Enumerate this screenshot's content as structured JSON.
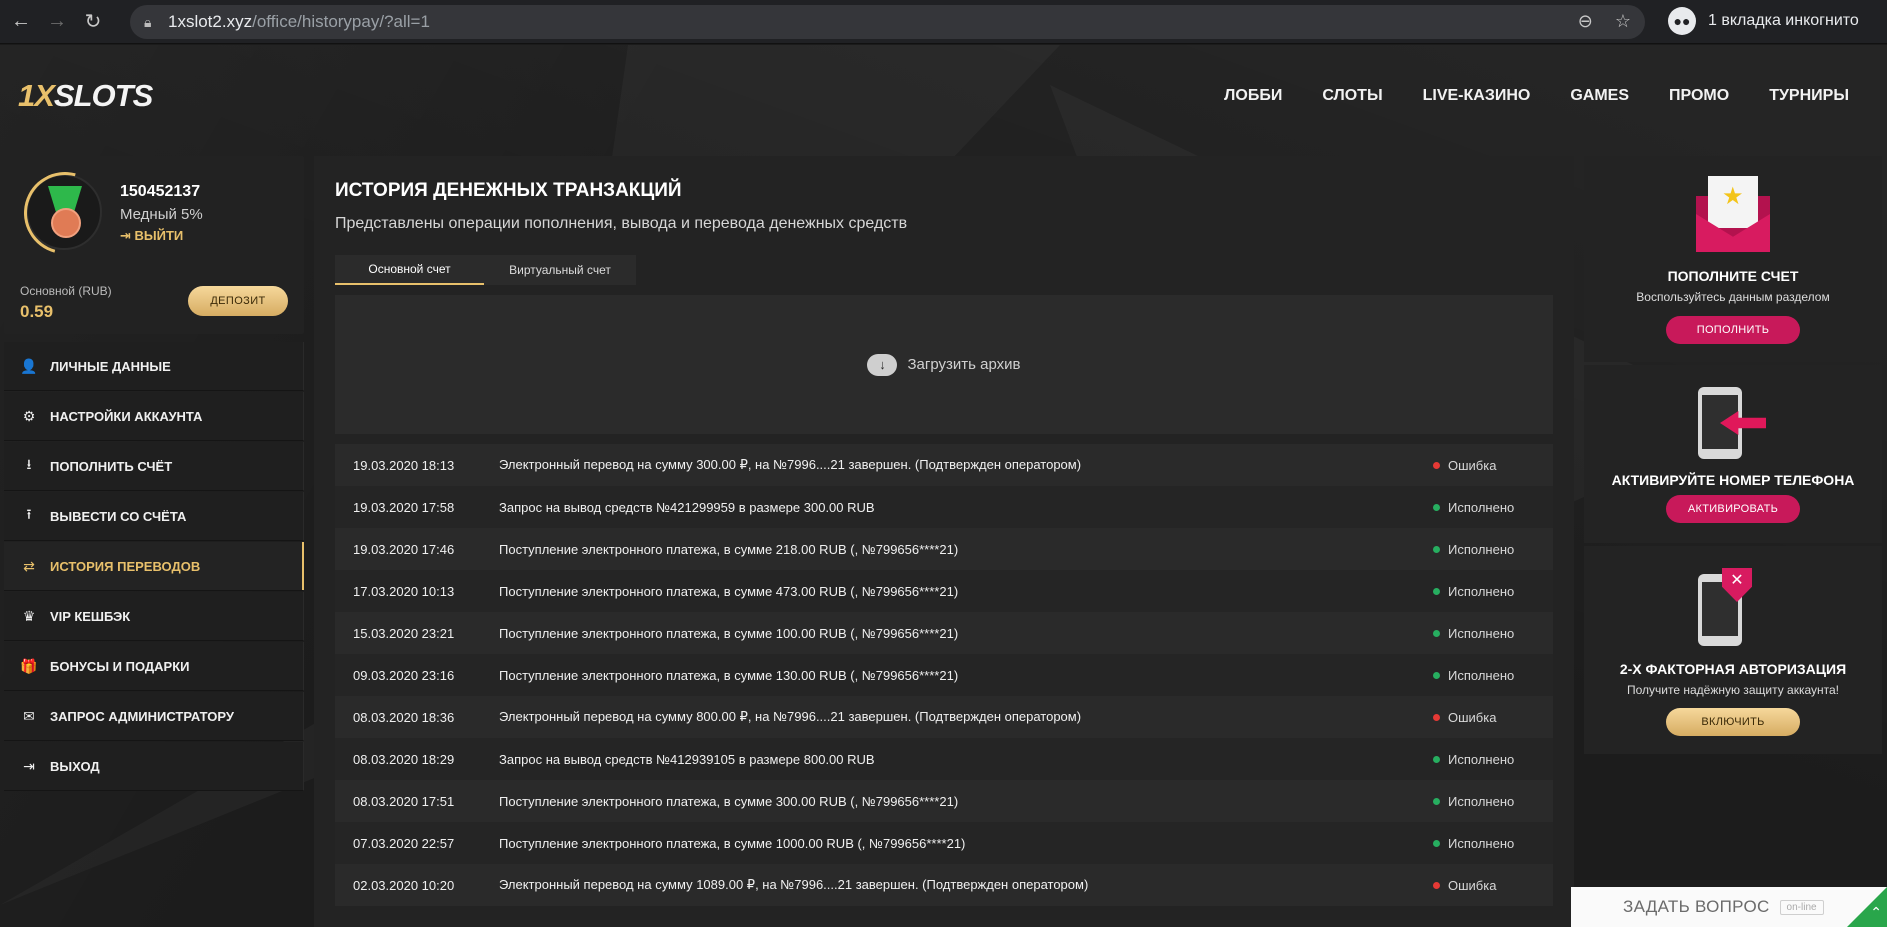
{
  "browser": {
    "url_host": "1xslot2.xyz",
    "url_path": "/office/historypay/?all=1",
    "incognito_label": "1 вкладка инкогнито"
  },
  "header": {
    "logo_one": "1X",
    "logo_rest": "SLOTS",
    "nav": [
      "ЛОББИ",
      "СЛОТЫ",
      "LIVE-КАЗИНО",
      "GAMES",
      "ПРОМО",
      "ТУРНИРЫ"
    ]
  },
  "profile": {
    "user_id": "150452137",
    "rank": "Медный 5%",
    "logout": "ВЫЙТИ",
    "account_label": "Основной (RUB)",
    "balance": "0.59",
    "deposit_label": "ДЕПОЗИТ"
  },
  "menu": [
    {
      "label": "ЛИЧНЫЕ ДАННЫЕ",
      "icon": "user-add-icon",
      "glyph": "👤"
    },
    {
      "label": "НАСТРОЙКИ АККАУНТА",
      "icon": "gears-icon",
      "glyph": "⚙"
    },
    {
      "label": "ПОПОЛНИТЬ СЧЁТ",
      "icon": "download-icon",
      "glyph": "⭳"
    },
    {
      "label": "ВЫВЕСТИ СО СЧЁТА",
      "icon": "upload-icon",
      "glyph": "⭱"
    },
    {
      "label": "ИСТОРИЯ ПЕРЕВОДОВ",
      "icon": "transfer-icon",
      "glyph": "⇄",
      "active": true
    },
    {
      "label": "VIP КЕШБЭК",
      "icon": "crown-icon",
      "glyph": "♛"
    },
    {
      "label": "БОНУСЫ И ПОДАРКИ",
      "icon": "gift-icon",
      "glyph": "🎁"
    },
    {
      "label": "ЗАПРОС АДМИНИСТРАТОРУ",
      "icon": "envelope-icon",
      "glyph": "✉"
    },
    {
      "label": "ВЫХОД",
      "icon": "exit-icon",
      "glyph": "⇥"
    }
  ],
  "main": {
    "title": "ИСТОРИЯ ДЕНЕЖНЫХ ТРАНЗАКЦИЙ",
    "subtitle": "Представлены операции пополнения, вывода и перевода денежных средств",
    "tabs": [
      "Основной счет",
      "Виртуальный счет"
    ],
    "archive_label": "Загрузить архив"
  },
  "transactions": [
    {
      "date": "19.03.2020 18:13",
      "desc": "Электронный перевод на сумму 300.00 ₽, на №7996....21 завершен. (Подтвержден оператором)",
      "status": "Ошибка",
      "ok": false
    },
    {
      "date": "19.03.2020 17:58",
      "desc": "Запрос на вывод средств №421299959 в размере 300.00 RUB",
      "status": "Исполнено",
      "ok": true
    },
    {
      "date": "19.03.2020 17:46",
      "desc": "Поступление электронного платежа, в сумме 218.00 RUB (, №799656****21)",
      "status": "Исполнено",
      "ok": true
    },
    {
      "date": "17.03.2020 10:13",
      "desc": "Поступление электронного платежа, в сумме 473.00 RUB (, №799656****21)",
      "status": "Исполнено",
      "ok": true
    },
    {
      "date": "15.03.2020 23:21",
      "desc": "Поступление электронного платежа, в сумме 100.00 RUB (, №799656****21)",
      "status": "Исполнено",
      "ok": true
    },
    {
      "date": "09.03.2020 23:16",
      "desc": "Поступление электронного платежа, в сумме 130.00 RUB (, №799656****21)",
      "status": "Исполнено",
      "ok": true
    },
    {
      "date": "08.03.2020 18:36",
      "desc": "Электронный перевод на сумму 800.00 ₽, на №7996....21 завершен. (Подтвержден оператором)",
      "status": "Ошибка",
      "ok": false
    },
    {
      "date": "08.03.2020 18:29",
      "desc": "Запрос на вывод средств №412939105 в размере 800.00 RUB",
      "status": "Исполнено",
      "ok": true
    },
    {
      "date": "08.03.2020 17:51",
      "desc": "Поступление электронного платежа, в сумме 300.00 RUB (, №799656****21)",
      "status": "Исполнено",
      "ok": true
    },
    {
      "date": "07.03.2020 22:57",
      "desc": "Поступление электронного платежа, в сумме 1000.00 RUB (, №799656****21)",
      "status": "Исполнено",
      "ok": true
    },
    {
      "date": "02.03.2020 10:20",
      "desc": "Электронный перевод на сумму 1089.00 ₽, на №7996....21 завершен. (Подтвержден оператором)",
      "status": "Ошибка",
      "ok": false
    }
  ],
  "promos": {
    "deposit": {
      "title": "ПОПОЛНИТЕ СЧЕТ",
      "text": "Воспользуйтесь данным разделом",
      "button": "ПОПОЛНИТЬ"
    },
    "phone": {
      "title": "АКТИВИРУЙТЕ НОМЕР ТЕЛЕФОНА",
      "button": "АКТИВИРОВАТЬ"
    },
    "twofa": {
      "title": "2-Х ФАКТОРНАЯ АВТОРИЗАЦИЯ",
      "text": "Получите надёжную защиту аккаунта!",
      "button": "ВКЛЮЧИТЬ"
    }
  },
  "chat": {
    "ask": "ЗАДАТЬ ВОПРОС",
    "online": "on-line"
  },
  "colors": {
    "accent": "#e8c06b",
    "pink": "#c8195a",
    "error": "#e53935",
    "success": "#27ae60"
  }
}
